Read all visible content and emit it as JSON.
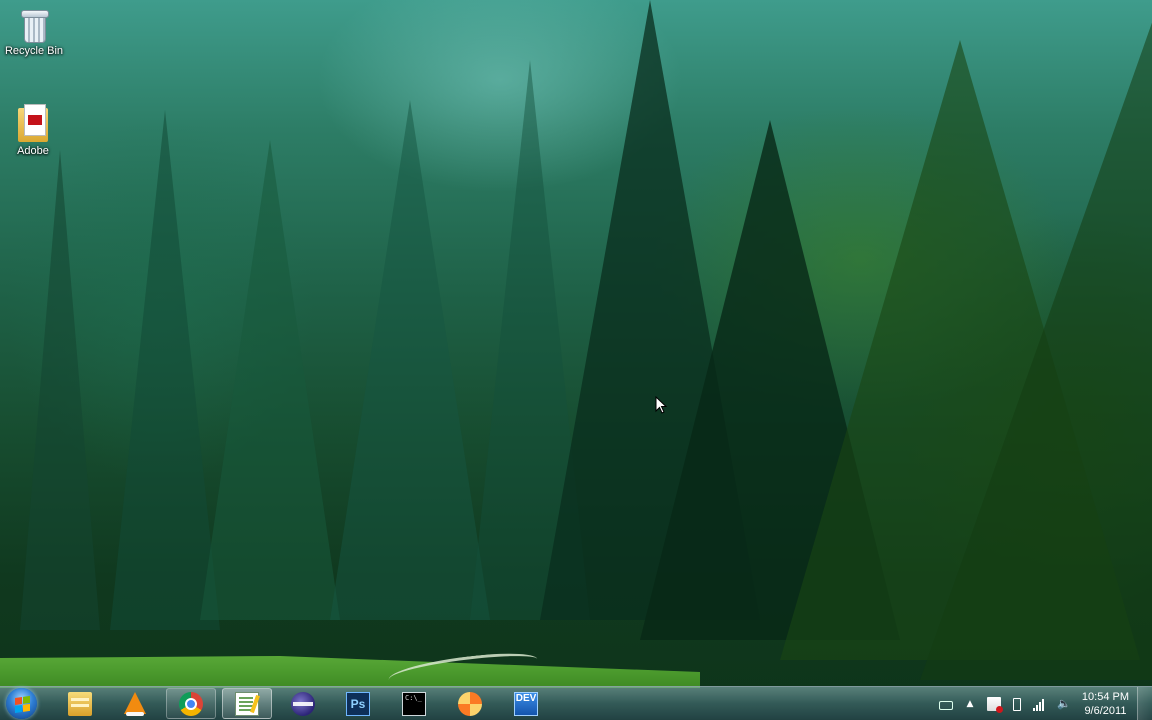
{
  "desktop": {
    "icons": [
      {
        "label": "Recycle Bin",
        "icon": "recycle-bin-icon"
      },
      {
        "label": "Adobe",
        "icon": "adobe-folder-icon"
      }
    ]
  },
  "taskbar": {
    "start": {
      "icon": "windows-start-orb-icon"
    },
    "pinned": [
      {
        "icon": "windows-explorer-icon",
        "state": "normal"
      },
      {
        "icon": "vlc-media-player-icon",
        "state": "normal"
      },
      {
        "icon": "google-chrome-icon",
        "state": "open"
      },
      {
        "icon": "notepad-plus-plus-icon",
        "state": "active"
      },
      {
        "icon": "eclipse-icon",
        "state": "normal"
      },
      {
        "icon": "photoshop-icon",
        "label": "Ps",
        "state": "normal"
      },
      {
        "icon": "command-prompt-icon",
        "label": "C:\\_",
        "state": "normal"
      },
      {
        "icon": "xampp-icon",
        "state": "normal"
      },
      {
        "icon": "dev-cpp-icon",
        "label": "DEV",
        "state": "normal"
      }
    ],
    "tray": {
      "icons": [
        "keyboard-icon",
        "show-hidden-icons-arrow-icon",
        "action-center-flag-icon",
        "battery-icon",
        "network-signal-icon",
        "volume-icon"
      ],
      "time": "10:54 PM",
      "date": "9/6/2011"
    }
  },
  "colors": {
    "forest_dark": "#0e3419",
    "forest_mid": "#1f6248",
    "forest_light": "#3f9c8c",
    "meadow": "#4b9a2d",
    "taskbar": "#466e78"
  }
}
